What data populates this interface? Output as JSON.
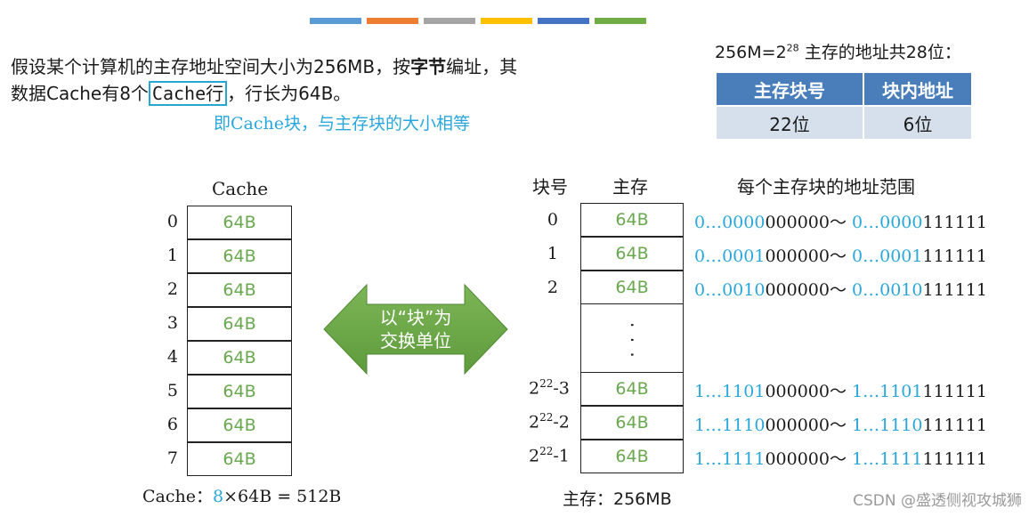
{
  "strip_colors": [
    "#5b9bd5",
    "#ed7d31",
    "#a5a5a5",
    "#ffc000",
    "#4472c4",
    "#70ad47"
  ],
  "intro": {
    "part1": "假设某个计算机的主存地址空间大小为256MB，按",
    "bold": "字节",
    "part2": "编址，其数据Cache有8个",
    "boxed": "Cache行",
    "part3": "，行长为64B。"
  },
  "note": "即Cache块，与主存块的大小相等",
  "bits": {
    "prefix": "256M=2",
    "exp": "28",
    "suffix": " 主存的地址共28位：",
    "headers": [
      "主存块号",
      "块内地址"
    ],
    "values": [
      "22位",
      "6位"
    ]
  },
  "cache": {
    "title": "Cache",
    "indices": [
      "0",
      "1",
      "2",
      "3",
      "4",
      "5",
      "6",
      "7"
    ],
    "cell_label": "64B",
    "footer_prefix": "Cache：",
    "footer_num": "8",
    "footer_rest": "×64B = 512B"
  },
  "arrow": {
    "line1": "以“块”为",
    "line2": "交换单位",
    "color": "#70ad47"
  },
  "memory": {
    "col_block": "块号",
    "col_mem": "主存",
    "col_range": "每个主存块的地址范围",
    "cell_label": "64B",
    "dots": "· · ·",
    "rows_top": [
      {
        "idx": "0",
        "b1": "0…0000",
        "k1": "000000",
        "sep": "～",
        "b2": "0…0000",
        "k2": "111111"
      },
      {
        "idx": "1",
        "b1": "0…0001",
        "k1": "000000",
        "sep": "～",
        "b2": "0…0001",
        "k2": "111111"
      },
      {
        "idx": "2",
        "b1": "0…0010",
        "k1": "000000",
        "sep": "～",
        "b2": "0…0010",
        "k2": "111111"
      }
    ],
    "rows_bottom": [
      {
        "base": "2",
        "exp": "22",
        "off": "-3",
        "b1": "1…1101",
        "k1": "000000",
        "sep": "～",
        "b2": "1…1101",
        "k2": "111111"
      },
      {
        "base": "2",
        "exp": "22",
        "off": "-2",
        "b1": "1…1110",
        "k1": "000000",
        "sep": "～",
        "b2": "1…1110",
        "k2": "111111"
      },
      {
        "base": "2",
        "exp": "22",
        "off": "-1",
        "b1": "1…1111",
        "k1": "000000",
        "sep": "～",
        "b2": "1…1111",
        "k2": "111111"
      }
    ],
    "footer": "主存：256MB"
  },
  "watermark": "CSDN @盛透侧视攻城狮"
}
